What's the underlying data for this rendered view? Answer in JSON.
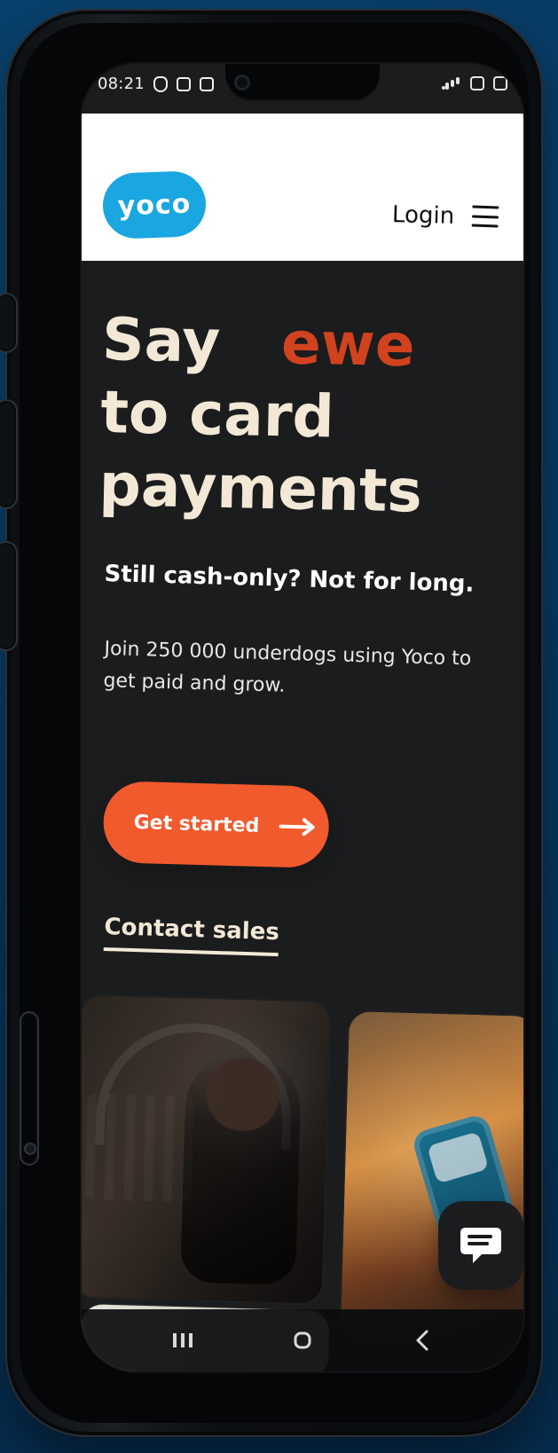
{
  "status_bar": {
    "time": "08:21"
  },
  "header": {
    "logo_text": "yoco",
    "login_label": "Login",
    "menu_icon": "hamburger-menu-icon"
  },
  "hero": {
    "headline_line1_prefix": "Say",
    "headline_line1_accent": "ewe",
    "headline_line2": "to card",
    "headline_line3": "payments",
    "subhead": "Still cash-only? Not for long.",
    "body": "Join 250 000 underdogs using Yoco to get paid and grow.",
    "primary_cta_label": "Get started",
    "primary_cta_icon": "arrow-right-icon",
    "secondary_cta_label": "Contact sales"
  },
  "floating_actions": {
    "chat_icon": "chat-icon"
  },
  "nav": {
    "recent_icon": "recent-apps-icon",
    "home_icon": "home-icon",
    "back_icon": "back-icon"
  },
  "colors": {
    "background_blue": "#083a63",
    "phone_black": "#0c0f12",
    "screen_dark": "#1b1c1d",
    "header_white": "#ffffff",
    "brand_blue": "#1aa6e0",
    "headline_cream": "#f2e8d5",
    "accent_red": "#d1421e",
    "cta_orange": "#f05a2d"
  }
}
